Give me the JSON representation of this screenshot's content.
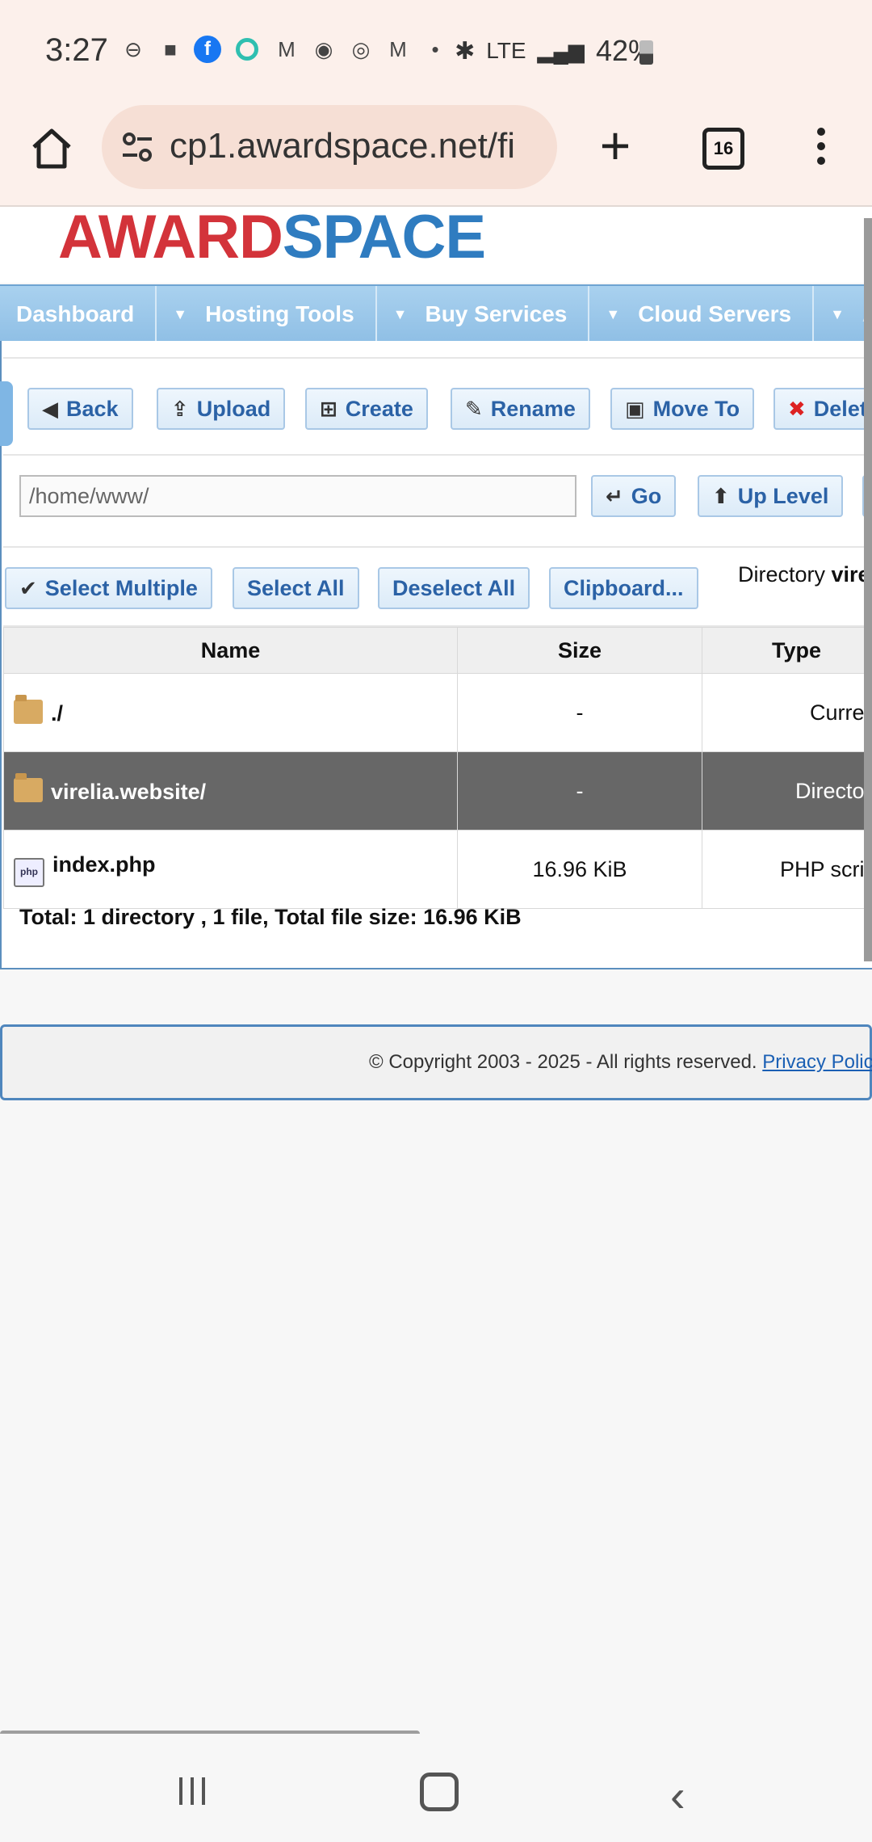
{
  "status_bar": {
    "time": "3:27",
    "network": "LTE",
    "battery": "42%",
    "notification_icons": [
      "do-not-disturb-icon",
      "chat-icon",
      "facebook-icon",
      "ring-icon",
      "gmail-icon",
      "app-icon",
      "instagram-icon",
      "gmail-icon",
      "dot-icon"
    ]
  },
  "browser": {
    "url": "cp1.awardspace.net/fi",
    "tab_count": "16"
  },
  "logo": {
    "part1": "AWARD",
    "part2": "SPACE"
  },
  "nav": {
    "items": [
      "Dashboard",
      "Hosting Tools",
      "Buy Services",
      "Cloud Servers",
      "A"
    ]
  },
  "toolbar": {
    "back": "Back",
    "upload": "Upload",
    "create": "Create",
    "rename": "Rename",
    "move_to": "Move To",
    "delete": "Delete"
  },
  "path_bar": {
    "value": "/home/www/",
    "go": "Go",
    "up_level": "Up Level"
  },
  "selection": {
    "select_multiple": "Select Multiple",
    "select_all": "Select All",
    "deselect_all": "Deselect All",
    "clipboard": "Clipboard...",
    "directory_prefix": "Directory",
    "directory_name": "virel"
  },
  "table": {
    "headers": [
      "Name",
      "Size",
      "Type"
    ],
    "rows": [
      {
        "name": "./",
        "size": "-",
        "type": "Current",
        "icon": "folder-icon",
        "selected": false
      },
      {
        "name": "virelia.website/",
        "size": "-",
        "type": "Directory",
        "icon": "folder-icon",
        "selected": true
      },
      {
        "name": "index.php",
        "size": "16.96 KiB",
        "type": "PHP script",
        "icon": "php-file-icon",
        "selected": false
      }
    ],
    "total": "Total: 1 directory , 1 file, Total file size: 16.96 KiB"
  },
  "footer": {
    "copyright": "© Copyright 2003 - 2025 - All rights reserved.",
    "privacy_link": "Privacy Polic"
  },
  "colors": {
    "nav_blue": "#8fbfe5",
    "logo_red": "#d3333a",
    "logo_blue": "#2f7cc0",
    "selected_row": "#676767"
  }
}
